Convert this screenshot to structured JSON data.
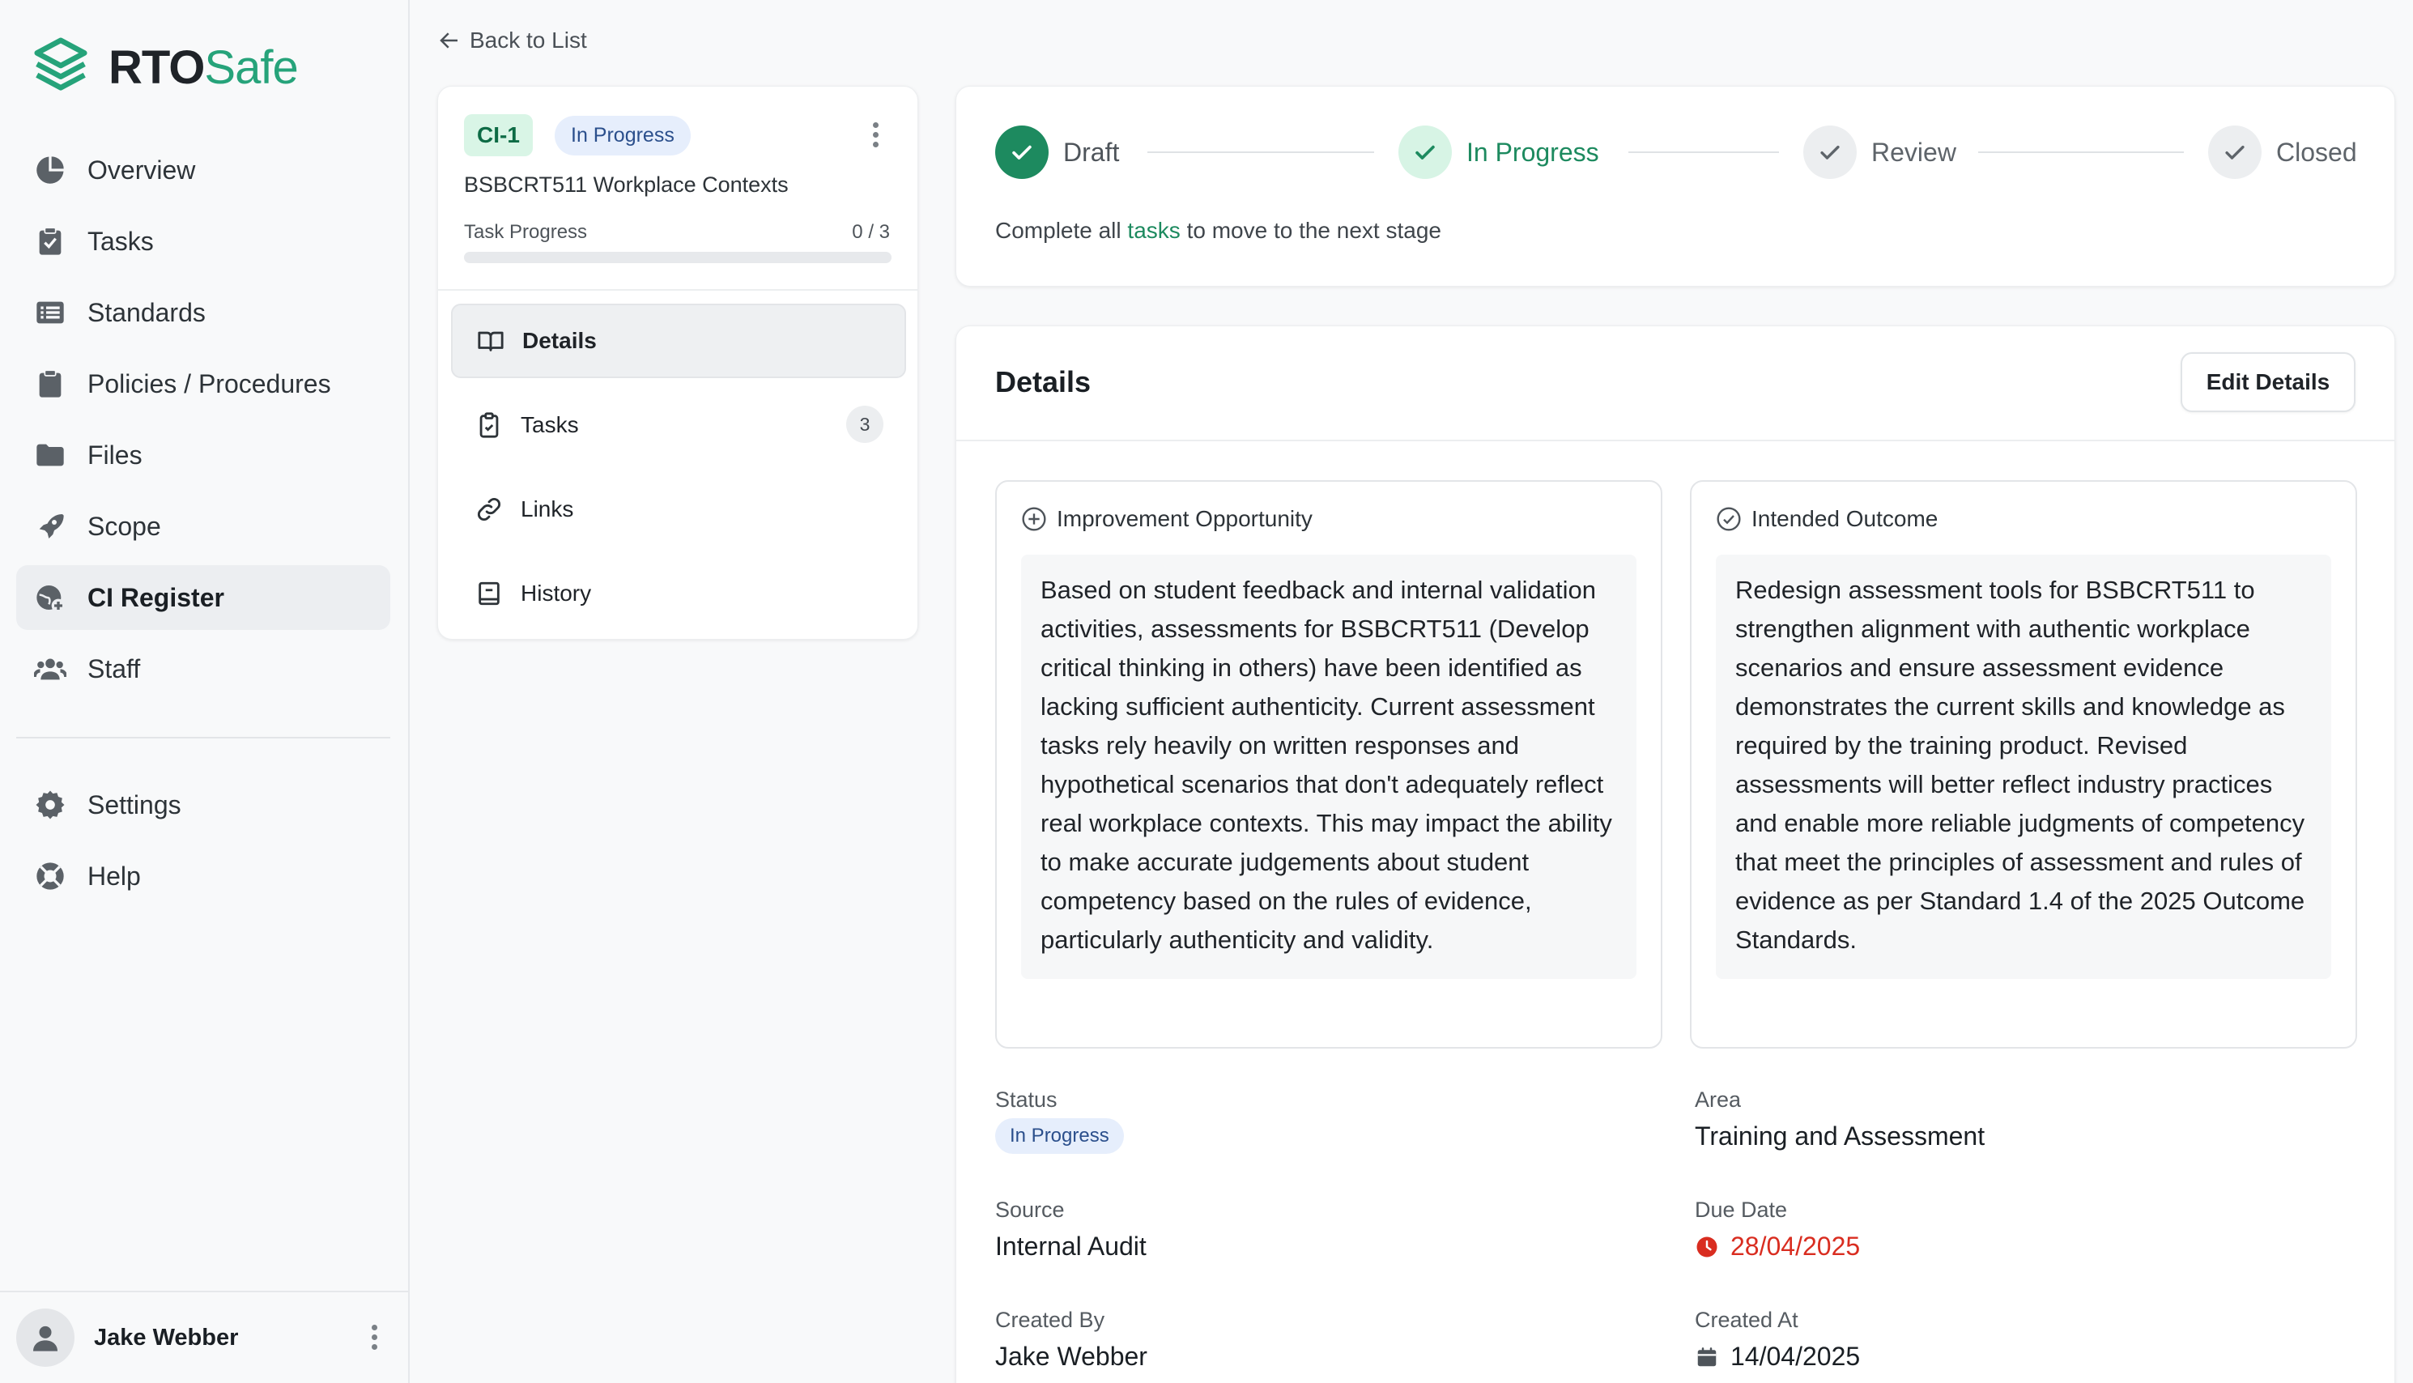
{
  "app": {
    "logo_rto": "RTO",
    "logo_safe": "Safe",
    "brand_color": "#26a37a"
  },
  "sidebar": {
    "items": [
      {
        "label": "Overview",
        "icon": "pie-chart-icon"
      },
      {
        "label": "Tasks",
        "icon": "clipboard-check-icon"
      },
      {
        "label": "Standards",
        "icon": "list-icon"
      },
      {
        "label": "Policies / Procedures",
        "icon": "clipboard-icon"
      },
      {
        "label": "Files",
        "icon": "folder-icon"
      },
      {
        "label": "Scope",
        "icon": "rocket-icon"
      },
      {
        "label": "CI Register",
        "icon": "globe-plus-icon",
        "active": true
      },
      {
        "label": "Staff",
        "icon": "users-icon"
      }
    ],
    "secondary": [
      {
        "label": "Settings",
        "icon": "gear-icon"
      },
      {
        "label": "Help",
        "icon": "lifebuoy-icon"
      }
    ],
    "user": {
      "name": "Jake Webber"
    }
  },
  "back": {
    "label": "Back to List"
  },
  "info": {
    "id": "CI-1",
    "status": "In Progress",
    "title": "BSBCRT511 Workplace Contexts",
    "progress_label": "Task Progress",
    "progress_text": "0 / 3",
    "progress_fraction": 0,
    "tabs": [
      {
        "label": "Details",
        "icon": "book-icon",
        "active": true
      },
      {
        "label": "Tasks",
        "icon": "clipboard-icon",
        "count": "3"
      },
      {
        "label": "Links",
        "icon": "link-icon"
      },
      {
        "label": "History",
        "icon": "history-icon"
      }
    ]
  },
  "stages": {
    "items": [
      {
        "label": "Draft",
        "state": "done"
      },
      {
        "label": "In Progress",
        "state": "current"
      },
      {
        "label": "Review",
        "state": "todo"
      },
      {
        "label": "Closed",
        "state": "todo"
      }
    ],
    "note_before": "Complete all",
    "note_link": "tasks",
    "note_after": "to move to the next stage"
  },
  "details": {
    "title": "Details",
    "edit_label": "Edit Details",
    "improvement": {
      "heading": "Improvement Opportunity",
      "text": "Based on student feedback and internal validation activities, assessments for BSBCRT511 (Develop critical thinking in others) have been identified as lacking sufficient authenticity. Current assessment tasks rely heavily on written responses and hypothetical scenarios that don't adequately reflect real workplace contexts. This may impact the ability to make accurate judgements about student competency based on the rules of evidence, particularly authenticity and validity."
    },
    "outcome": {
      "heading": "Intended Outcome",
      "text": "Redesign assessment tools for BSBCRT511 to strengthen alignment with authentic workplace scenarios and ensure assessment evidence demonstrates the current skills and knowledge as required by the training product. Revised assessments will better reflect industry practices and enable more reliable judgments of competency that meet the principles of assessment and rules of evidence as per Standard 1.4 of the 2025 Outcome Standards."
    },
    "fields": {
      "status_label": "Status",
      "status_value": "In Progress",
      "area_label": "Area",
      "area_value": "Training and Assessment",
      "source_label": "Source",
      "source_value": "Internal Audit",
      "due_label": "Due Date",
      "due_value": "28/04/2025",
      "created_by_label": "Created By",
      "created_by_value": "Jake Webber",
      "created_at_label": "Created At",
      "created_at_value": "14/04/2025"
    },
    "due_color": "#d92d20"
  }
}
